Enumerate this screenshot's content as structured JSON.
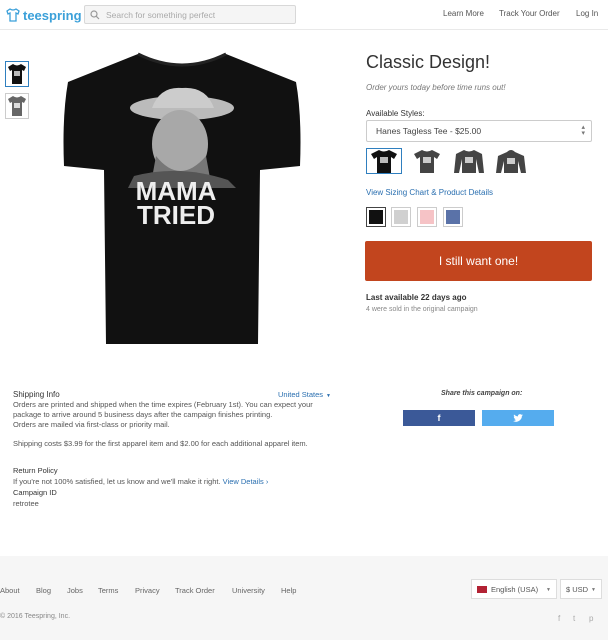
{
  "brand": {
    "name": "teespring",
    "color": "#3ba0d9"
  },
  "search": {
    "placeholder": "Search for something perfect",
    "icon": "search-icon"
  },
  "nav": {
    "learn_more": "Learn More",
    "track_order": "Track Your Order",
    "login": "Log In"
  },
  "product": {
    "title": "Classic Design!",
    "subtitle": "Order yours today before time runs out!",
    "shirt_text_line1": "MAMA",
    "shirt_text_line2": "TRIED",
    "styles_label": "Available Styles:",
    "selected_style": "Hanes Tagless Tee - $25.00",
    "sizing_link": "View Sizing Chart & Product Details",
    "colors": [
      "#111111",
      "#d0d0d0",
      "#f6c3c6",
      "#5a72a8"
    ],
    "buy_label": "I still want one!",
    "buy_color": "#c2451e",
    "last_available_prefix": "Last available",
    "last_available_value": "22 days ago",
    "sold_text": "4 were sold in the original campaign"
  },
  "shipping": {
    "title": "Shipping Info",
    "country": "United States",
    "p1_line1": "Orders are printed and shipped when the time expires (February 1st). You can expect your",
    "p1_line2": "package to arrive around 5 business days after the campaign finishes printing.",
    "p1_line3": "Orders are mailed via first-class or priority mail.",
    "p2": "Shipping costs $3.99 for the first apparel item and $2.00 for each additional apparel item."
  },
  "share": {
    "title": "Share this campaign on:",
    "facebook": "f",
    "twitter_icon": "twitter-icon"
  },
  "return_policy": {
    "title": "Return Policy",
    "text": "If you're not 100% satisfied, let us know and we'll make it right.",
    "link": "View Details"
  },
  "campaign": {
    "title": "Campaign ID",
    "id": "retrotee"
  },
  "footer": {
    "links": [
      "About",
      "Blog",
      "Jobs",
      "Terms",
      "Privacy",
      "Track Order",
      "University",
      "Help"
    ],
    "language": "English (USA)",
    "currency": "$ USD",
    "copyright": "© 2016 Teespring, Inc.",
    "social": [
      "f",
      "t",
      "p"
    ]
  }
}
